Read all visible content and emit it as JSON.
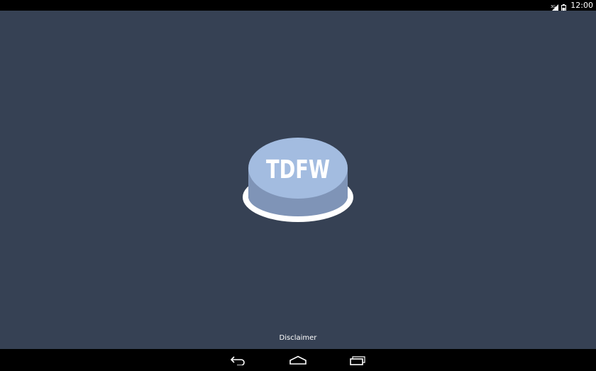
{
  "status_bar": {
    "time": "12:00",
    "icons": [
      "signal-icon",
      "battery-icon"
    ]
  },
  "main": {
    "background_color": "#364154",
    "button": {
      "label": "TDFW",
      "top_color": "#a3bce0",
      "side_color": "#7f94b7",
      "ring_color": "#ffffff",
      "label_color": "#ffffff"
    },
    "disclaimer_label": "Disclaimer"
  },
  "nav_bar": {
    "buttons": [
      "back-icon",
      "home-icon",
      "recents-icon"
    ]
  }
}
